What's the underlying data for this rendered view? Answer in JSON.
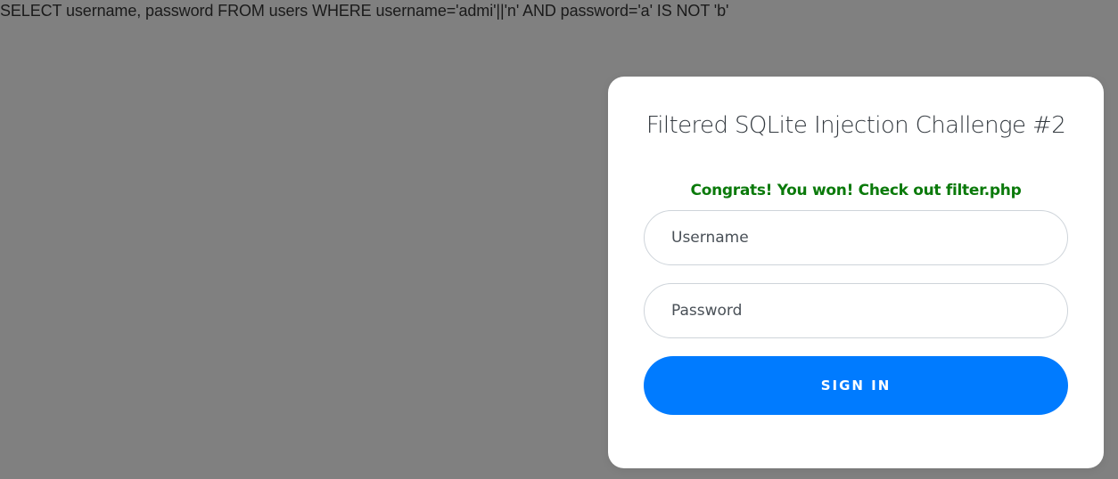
{
  "debug_query": "SELECT username, password FROM users WHERE username='admi'||'n' AND password='a' IS NOT 'b'",
  "login": {
    "title": "Filtered SQLite Injection Challenge #2",
    "message": "Congrats! You won! Check out filter.php",
    "username_placeholder": "Username",
    "password_placeholder": "Password",
    "submit_label": "SIGN IN"
  },
  "colors": {
    "page_background": "#808080",
    "card_background": "#ffffff",
    "success_text": "#0b7a0b",
    "button_primary": "#007bff",
    "button_text": "#ffffff"
  }
}
